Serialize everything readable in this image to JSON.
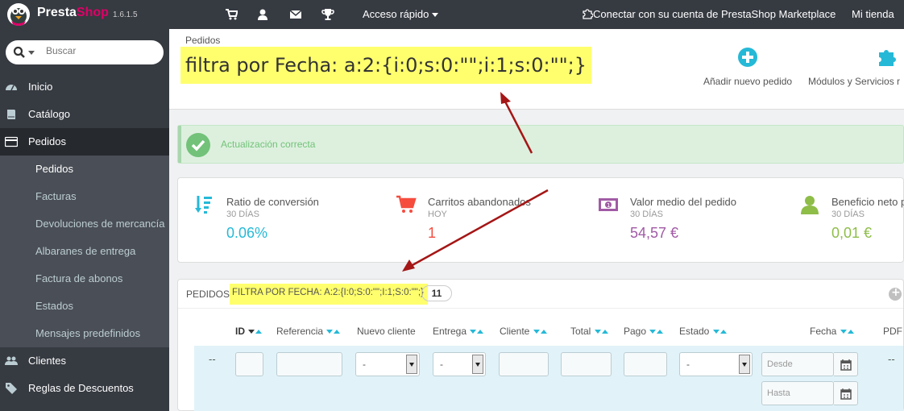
{
  "topbar": {
    "brand_presta": "Presta",
    "brand_shop": "Shop",
    "version": "1.6.1.5",
    "icons": [
      "cart-icon",
      "user-icon",
      "envelope-icon",
      "trophy-icon"
    ],
    "quick_access": "Acceso rápido",
    "connect": "Conectar con su cuenta de PrestaShop Marketplace",
    "my_store": "Mi tienda"
  },
  "sidebar": {
    "search_placeholder": "Buscar",
    "main_items": [
      {
        "label": "Inicio",
        "icon": "dashboard-icon"
      },
      {
        "label": "Catálogo",
        "icon": "book-icon"
      },
      {
        "label": "Pedidos",
        "icon": "credit-card-icon",
        "active": true
      },
      {
        "label": "Clientes",
        "icon": "users-icon"
      },
      {
        "label": "Reglas de Descuentos",
        "icon": "tags-icon"
      }
    ],
    "sub_items": [
      {
        "label": "Pedidos",
        "active": true
      },
      {
        "label": "Facturas"
      },
      {
        "label": "Devoluciones de mercancía"
      },
      {
        "label": "Albaranes de entrega"
      },
      {
        "label": "Factura de abonos"
      },
      {
        "label": "Estados"
      },
      {
        "label": "Mensajes predefinidos"
      }
    ]
  },
  "header": {
    "breadcrumb": "Pedidos",
    "title": "filtra por Fecha: a:2:{i:0;s:0:\"\";i:1;s:0:\"\";}",
    "toolbar": [
      {
        "label": "Añadir nuevo pedido",
        "icon": "plus-circle-icon"
      },
      {
        "label": "Módulos y Servicios r",
        "icon": "puzzle-icon"
      }
    ]
  },
  "alert": {
    "message": "Actualización correcta",
    "color": "#72c279"
  },
  "kpis": [
    {
      "title": "Ratio de conversión",
      "period": "30 DÍAS",
      "value": "0.06%",
      "icon": "sort-amount-icon",
      "color": "#25b9d7"
    },
    {
      "title": "Carritos abandonados",
      "period": "HOY",
      "value": "1",
      "icon": "shopping-cart-icon",
      "color": "#f54c3e"
    },
    {
      "title": "Valor medio del pedido",
      "period": "30 DÍAS",
      "value": "54,57 €",
      "icon": "money-icon",
      "color": "#a15aa5"
    },
    {
      "title": "Beneficio neto p",
      "period": "30 DÍAS",
      "value": "0,01 €",
      "icon": "user-icon",
      "color": "#8ebd48"
    }
  ],
  "list": {
    "prefix": "PEDIDOS >",
    "filter": "FILTRA POR FECHA: A:2:{I:0;S:0:\"\";I:1;S:0:\"\";}",
    "count": "11",
    "columns": [
      "ID",
      "Referencia",
      "Nuevo cliente",
      "Entrega",
      "Cliente",
      "Total",
      "Pago",
      "Estado",
      "Fecha",
      "PDF"
    ],
    "filters": {
      "dash": "--",
      "select_value": "-",
      "date_from_placeholder": "Desde",
      "date_to_placeholder": "Hasta",
      "pdf_dash": "--"
    }
  }
}
